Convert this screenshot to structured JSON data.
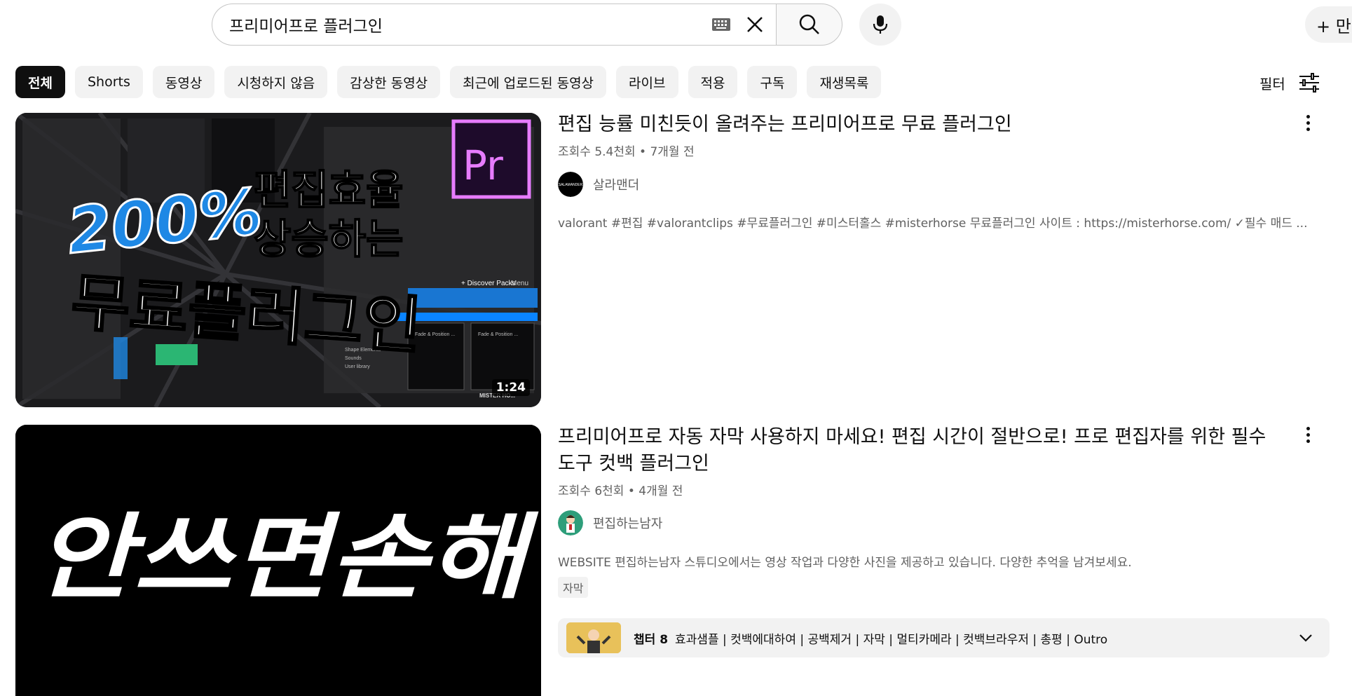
{
  "search": {
    "query": "프리미어프로 플러그인"
  },
  "header": {
    "create_label": "+ 만"
  },
  "chips": [
    {
      "label": "전체",
      "active": true
    },
    {
      "label": "Shorts",
      "active": false
    },
    {
      "label": "동영상",
      "active": false
    },
    {
      "label": "시청하지 않음",
      "active": false
    },
    {
      "label": "감상한 동영상",
      "active": false
    },
    {
      "label": "최근에 업로드된 동영상",
      "active": false
    },
    {
      "label": "라이브",
      "active": false
    },
    {
      "label": "적용",
      "active": false
    },
    {
      "label": "구독",
      "active": false
    },
    {
      "label": "재생목록",
      "active": false
    }
  ],
  "filter_label": "필터",
  "results": [
    {
      "title": "편집 능률 미친듯이 올려주는 프리미어프로 무료 플러그인",
      "meta": "조회수 5.4천회 • 7개월 전",
      "channel": "살라맨더",
      "avatar_text": "SALAMANDER",
      "description": "valorant #편집 #valorantclips #무료플러그인 #미스터홀스 #misterhorse 무료플러그인 사이트 : https://misterhorse.com/ ✓필수 매드 ...",
      "duration": "1:24",
      "thumb": {
        "big_percent": "200%",
        "line1": "편집효율",
        "line2": "상승하는",
        "line3": "무료플러그인",
        "logo": "Pr",
        "panel_button": "+ Discover Packs",
        "panel_menu": "Menu",
        "panel_item1": "Shape Elements",
        "panel_item2": "Sounds",
        "panel_item3": "User library",
        "panel_item4": "Fade & Position ...",
        "panel_item5": "Fade & Position ...",
        "watermark": "MISTER HO..."
      }
    },
    {
      "title": "프리미어프로 자동 자막 사용하지 마세요! 편집 시간이 절반으로! 프로 편집자를 위한 필수 도구 컷백 플러그인",
      "meta": "조회수 6천회 • 4개월 전",
      "channel": "편집하는남자",
      "description": "WEBSITE 편집하는남자 스튜디오에서는 영상 작업과 다양한 사진을 제공하고 있습니다. 다양한 추억을 남겨보세요.",
      "badge": "자막",
      "thumb": {
        "text": "안쓰면손해"
      },
      "chapters": {
        "label": "챕터 8",
        "text": "효과샘플 | 컷백에대하여 | 공백제거 | 자막 | 멀티카메라 | 컷백브라우저 | 총평 | Outro"
      }
    }
  ],
  "colors": {
    "accent_bar": "#0a84ff",
    "premiere_purple": "#e77cff",
    "premiere_bg": "#1e0b2b",
    "text_primary": "#0f0f0f",
    "text_secondary": "#606060",
    "chip_bg": "#f2f2f2"
  }
}
